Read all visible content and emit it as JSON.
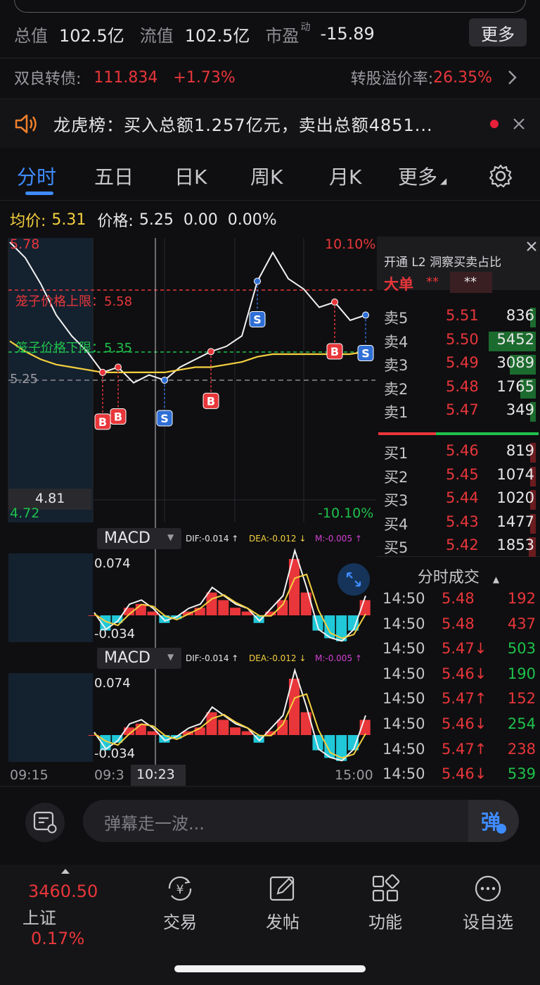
{
  "stats": {
    "total_value_label": "总值",
    "total_value": "102.5亿",
    "float_value_label": "流值",
    "float_value": "102.5亿",
    "pe_label": "市盈",
    "pe_sup": "动",
    "pe_value": "-15.89",
    "more_button": "更多"
  },
  "bond": {
    "label": "双良转债:",
    "price": "111.834",
    "change": "+1.73%",
    "premium_label": "转股溢价率:",
    "premium_value": "26.35%"
  },
  "dragon_tiger": {
    "text": "龙虎榜：买入总额1.257亿元，卖出总额4851..."
  },
  "tabs": [
    "分时",
    "五日",
    "日K",
    "周K",
    "月K",
    "更多"
  ],
  "price_line": {
    "avg_label": "均价:",
    "avg_value": "5.31",
    "price_label": "价格:",
    "price_value": "5.25",
    "change": "0.00",
    "change_pct": "0.00%"
  },
  "chart": {
    "y_top": "5.78",
    "y_ref": "5.25",
    "y_bottom": "4.72",
    "pct_top": "10.10%",
    "pct_bottom": "-10.10%",
    "upper_limit_label": "笼子价格上限：5.58",
    "lower_limit_label": "笼子价格下限：5.35",
    "crosshair_price": "4.81",
    "crosshair_time": "10:23",
    "time_start": "09:15",
    "time_open": "09:3",
    "time_end": "15:00",
    "macd_label": "MACD",
    "macd_dif": "DIF:-0.014 ↑",
    "macd_dea": "DEA:-0.012 ↓",
    "macd_m": "M:-0.005 ↑",
    "macd_top": "0.074",
    "macd_bottom": "-0.034",
    "colors": {
      "up": "#e8363a",
      "down": "#1fc14b",
      "avg": "#f4d03f",
      "accent": "#3f8cff"
    }
  },
  "chart_data": {
    "type": "line",
    "title": "",
    "ylim": [
      4.72,
      5.78
    ],
    "reference_price": 5.25,
    "series": [
      {
        "name": "价格",
        "values": [
          5.78,
          5.72,
          5.62,
          5.5,
          5.42,
          5.36,
          5.28,
          5.3,
          5.24,
          5.27,
          5.25,
          5.3,
          5.33,
          5.36,
          5.38,
          5.42,
          5.63,
          5.74,
          5.64,
          5.6,
          5.53,
          5.55,
          5.48,
          5.5
        ]
      },
      {
        "name": "均价",
        "values": [
          5.4,
          5.36,
          5.33,
          5.31,
          5.3,
          5.29,
          5.28,
          5.28,
          5.28,
          5.28,
          5.28,
          5.29,
          5.3,
          5.3,
          5.31,
          5.32,
          5.34,
          5.35,
          5.35,
          5.35,
          5.35,
          5.35,
          5.35,
          5.36
        ]
      }
    ],
    "markers": [
      {
        "label": "B",
        "index": 6
      },
      {
        "label": "B",
        "index": 7
      },
      {
        "label": "S",
        "index": 10
      },
      {
        "label": "B",
        "index": 13
      },
      {
        "label": "S",
        "index": 16
      },
      {
        "label": "B",
        "index": 21
      },
      {
        "label": "S",
        "index": 23
      }
    ],
    "macd_hist": [
      0.0,
      -0.02,
      -0.01,
      0.01,
      0.015,
      0.005,
      -0.01,
      -0.005,
      0.005,
      0.01,
      0.03,
      0.02,
      0.01,
      0.005,
      -0.01,
      0.005,
      0.02,
      0.074,
      0.03,
      -0.02,
      -0.03,
      -0.034,
      -0.02,
      0.02
    ]
  },
  "orderbook": {
    "header": "开通 L2 洞察买卖占比",
    "big_order_label": "大单",
    "big_order_value": "**",
    "big_order_value2": "**",
    "asks": [
      {
        "name": "卖5",
        "price": "5.51",
        "qty": "836",
        "ratio": 0.06
      },
      {
        "name": "卖4",
        "price": "5.50",
        "qty": "5452",
        "ratio": 0.9
      },
      {
        "name": "卖3",
        "price": "5.49",
        "qty": "3089",
        "ratio": 0.5
      },
      {
        "name": "卖2",
        "price": "5.48",
        "qty": "1765",
        "ratio": 0.3
      },
      {
        "name": "卖1",
        "price": "5.47",
        "qty": "349",
        "ratio": 0.04
      }
    ],
    "bids": [
      {
        "name": "买1",
        "price": "5.46",
        "qty": "819",
        "ratio": 0.05
      },
      {
        "name": "买2",
        "price": "5.45",
        "qty": "1074",
        "ratio": 0.08
      },
      {
        "name": "买3",
        "price": "5.44",
        "qty": "1020",
        "ratio": 0.07
      },
      {
        "name": "买4",
        "price": "5.43",
        "qty": "1477",
        "ratio": 0.1
      },
      {
        "name": "买5",
        "price": "5.42",
        "qty": "1853",
        "ratio": 0.14
      }
    ]
  },
  "trades": {
    "title": "分时成交",
    "rows": [
      {
        "time": "14:50",
        "price": "5.48",
        "vol": "192",
        "dir": "up"
      },
      {
        "time": "14:50",
        "price": "5.48",
        "vol": "437",
        "dir": "up"
      },
      {
        "time": "14:50",
        "price": "5.47↓",
        "vol": "503",
        "dir": "down"
      },
      {
        "time": "14:50",
        "price": "5.46↓",
        "vol": "190",
        "dir": "down"
      },
      {
        "time": "14:50",
        "price": "5.47↑",
        "vol": "152",
        "dir": "up"
      },
      {
        "time": "14:50",
        "price": "5.46↓",
        "vol": "254",
        "dir": "down"
      },
      {
        "time": "14:50",
        "price": "5.47↑",
        "vol": "238",
        "dir": "up"
      },
      {
        "time": "14:50",
        "price": "5.46↓",
        "vol": "539",
        "dir": "down"
      }
    ]
  },
  "danmu": {
    "placeholder": "弹幕走一波...",
    "send": "弹"
  },
  "nav": {
    "index_value": "3460.50",
    "index_name": "上证",
    "index_change": "0.17%",
    "trade": "交易",
    "post": "发帖",
    "function": "功能",
    "watchlist": "设自选"
  }
}
